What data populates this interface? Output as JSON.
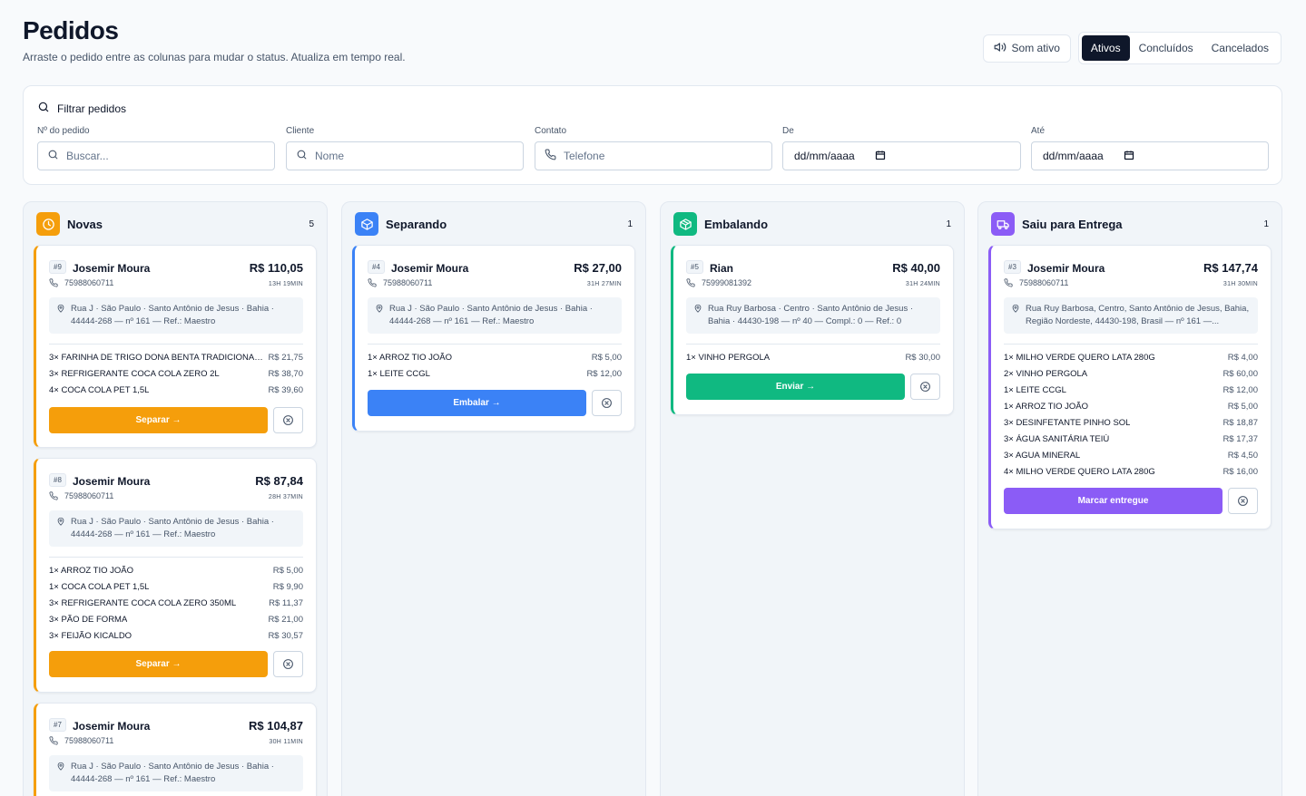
{
  "page": {
    "title": "Pedidos",
    "subtitle": "Arraste o pedido entre as colunas para mudar o status. Atualiza em tempo real."
  },
  "top": {
    "sound_label": "Som ativo",
    "tabs": [
      "Ativos",
      "Concluídos",
      "Cancelados"
    ],
    "active_tab": "Ativos"
  },
  "filter": {
    "title": "Filtrar pedidos",
    "order_label": "Nº do pedido",
    "order_placeholder": "Buscar...",
    "client_label": "Cliente",
    "client_placeholder": "Nome",
    "contact_label": "Contato",
    "contact_placeholder": "Telefone",
    "from_label": "De",
    "from_value": "dd/mm/aaaa",
    "to_label": "Até",
    "to_value": "dd/mm/aaaa"
  },
  "colors": {
    "novas": "#f59e0b",
    "separando": "#3b82f6",
    "embalando": "#10b981",
    "entrega": "#8b5cf6"
  },
  "columns": [
    {
      "title": "Novas",
      "count": "5",
      "action_label": "Separar →",
      "cards": [
        {
          "id": "#9",
          "name": "Josemir Moura",
          "price": "R$ 110,05",
          "phone": "75988060711",
          "time": "13H 19MIN",
          "address": "Rua J · São Paulo · Santo Antônio de Jesus · Bahia · 44444-268 — nº 161 — Ref.: Maestro",
          "items": [
            {
              "name": "3× FARINHA DE TRIGO DONA BENTA TRADICIONAL...",
              "price": "R$ 21,75"
            },
            {
              "name": "3× REFRIGERANTE COCA COLA ZERO 2L",
              "price": "R$ 38,70"
            },
            {
              "name": "4× COCA COLA PET 1,5L",
              "price": "R$ 39,60"
            }
          ]
        },
        {
          "id": "#8",
          "name": "Josemir Moura",
          "price": "R$ 87,84",
          "phone": "75988060711",
          "time": "28H 37MIN",
          "address": "Rua J · São Paulo · Santo Antônio de Jesus · Bahia · 44444-268 — nº 161 — Ref.: Maestro",
          "items": [
            {
              "name": "1× ARROZ TIO JOÃO",
              "price": "R$ 5,00"
            },
            {
              "name": "1× COCA COLA PET 1,5L",
              "price": "R$ 9,90"
            },
            {
              "name": "3× REFRIGERANTE COCA COLA ZERO 350ML",
              "price": "R$ 11,37"
            },
            {
              "name": "3× PÃO DE FORMA",
              "price": "R$ 21,00"
            },
            {
              "name": "3× FEIJÃO KICALDO",
              "price": "R$ 30,57"
            }
          ]
        },
        {
          "id": "#7",
          "name": "Josemir Moura",
          "price": "R$ 104,87",
          "phone": "75988060711",
          "time": "30H 11MIN",
          "address": "Rua J · São Paulo · Santo Antônio de Jesus · Bahia · 44444-268 — nº 161 — Ref.: Maestro",
          "items": []
        }
      ]
    },
    {
      "title": "Separando",
      "count": "1",
      "action_label": "Embalar →",
      "cards": [
        {
          "id": "#4",
          "name": "Josemir Moura",
          "price": "R$ 27,00",
          "phone": "75988060711",
          "time": "31H 27MIN",
          "address": "Rua J · São Paulo · Santo Antônio de Jesus · Bahia · 44444-268 — nº 161 — Ref.: Maestro",
          "items": [
            {
              "name": "1× ARROZ TIO JOÃO",
              "price": "R$ 5,00"
            },
            {
              "name": "1× LEITE CCGL",
              "price": "R$ 12,00"
            }
          ]
        }
      ]
    },
    {
      "title": "Embalando",
      "count": "1",
      "action_label": "Enviar →",
      "cards": [
        {
          "id": "#5",
          "name": "Rian",
          "price": "R$ 40,00",
          "phone": "75999081392",
          "time": "31H 24MIN",
          "address": "Rua Ruy Barbosa · Centro · Santo Antônio de Jesus · Bahia · 44430-198 — nº 40 — Compl.: 0 — Ref.: 0",
          "items": [
            {
              "name": "1× VINHO PERGOLA",
              "price": "R$ 30,00"
            }
          ]
        }
      ]
    },
    {
      "title": "Saiu para Entrega",
      "count": "1",
      "action_label": "Marcar entregue",
      "cards": [
        {
          "id": "#3",
          "name": "Josemir Moura",
          "price": "R$ 147,74",
          "phone": "75988060711",
          "time": "31H 30MIN",
          "address": "Rua Ruy Barbosa, Centro, Santo Antônio de Jesus, Bahia, Região Nordeste, 44430-198, Brasil — nº 161 —...",
          "items": [
            {
              "name": "1× MILHO VERDE QUERO LATA 280G",
              "price": "R$ 4,00"
            },
            {
              "name": "2× VINHO PERGOLA",
              "price": "R$ 60,00"
            },
            {
              "name": "1× LEITE CCGL",
              "price": "R$ 12,00"
            },
            {
              "name": "1× ARROZ TIO JOÃO",
              "price": "R$ 5,00"
            },
            {
              "name": "3× DESINFETANTE PINHO SOL",
              "price": "R$ 18,87"
            },
            {
              "name": "3× ÁGUA SANITÁRIA TEIÚ",
              "price": "R$ 17,37"
            },
            {
              "name": "3× AGUA MINERAL",
              "price": "R$ 4,50"
            },
            {
              "name": "4× MILHO VERDE QUERO LATA 280G",
              "price": "R$ 16,00"
            }
          ]
        }
      ]
    }
  ]
}
